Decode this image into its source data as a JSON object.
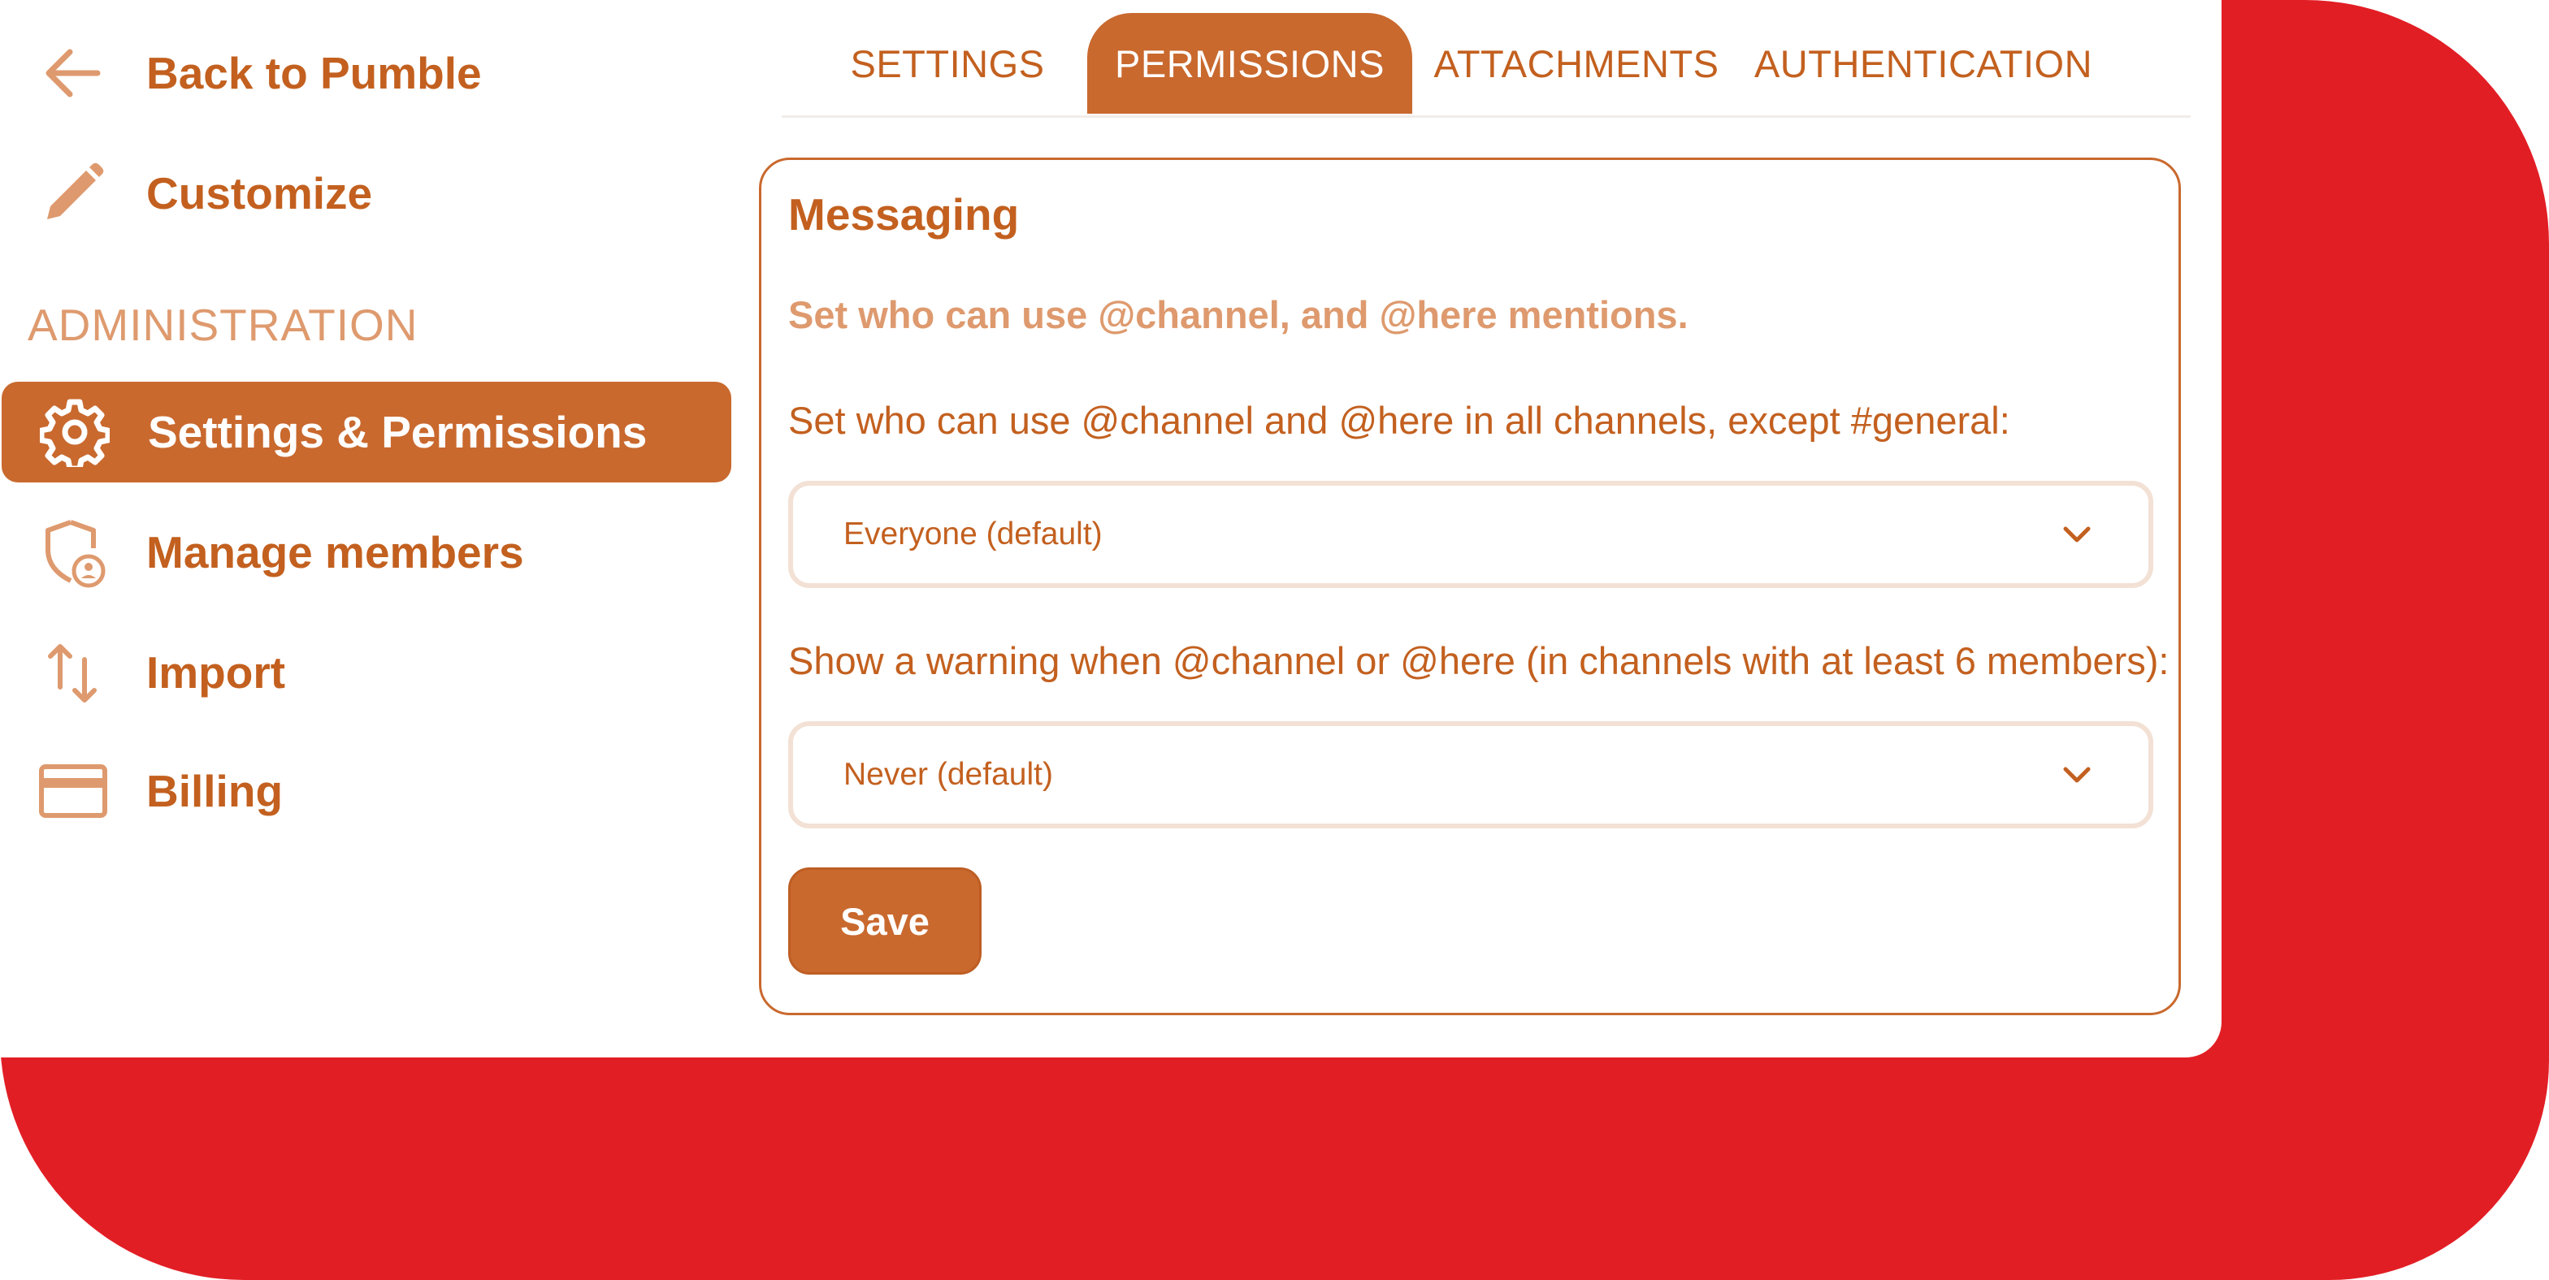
{
  "colors": {
    "accent": "#C9692E",
    "text": "#C3601F",
    "muted": "#DE9A6E",
    "background_red": "#E21E25"
  },
  "sidebar": {
    "back_label": "Back to Pumble",
    "back_icon": "arrow-left-icon",
    "customize_label": "Customize",
    "customize_icon": "pencil-icon",
    "section_label": "ADMINISTRATION",
    "items": [
      {
        "label": "Settings & Permissions",
        "icon": "gear-icon",
        "active": true
      },
      {
        "label": "Manage members",
        "icon": "shield-user-icon",
        "active": false
      },
      {
        "label": "Import",
        "icon": "arrows-up-down-icon",
        "active": false
      },
      {
        "label": "Billing",
        "icon": "credit-card-icon",
        "active": false
      }
    ]
  },
  "tabs": [
    {
      "label": "SETTINGS",
      "active": false
    },
    {
      "label": "PERMISSIONS",
      "active": true
    },
    {
      "label": "ATTACHMENTS",
      "active": false
    },
    {
      "label": "AUTHENTICATION",
      "active": false
    }
  ],
  "messaging": {
    "title": "Messaging",
    "description": "Set who can use @channel, and @here mentions.",
    "field1_label": "Set who can use @channel and @here in all channels, except #general:",
    "field1_value": "Everyone (default)",
    "field2_label": "Show a warning when @channel or @here (in channels with at least 6 members):",
    "field2_value": "Never (default)",
    "save_label": "Save"
  }
}
